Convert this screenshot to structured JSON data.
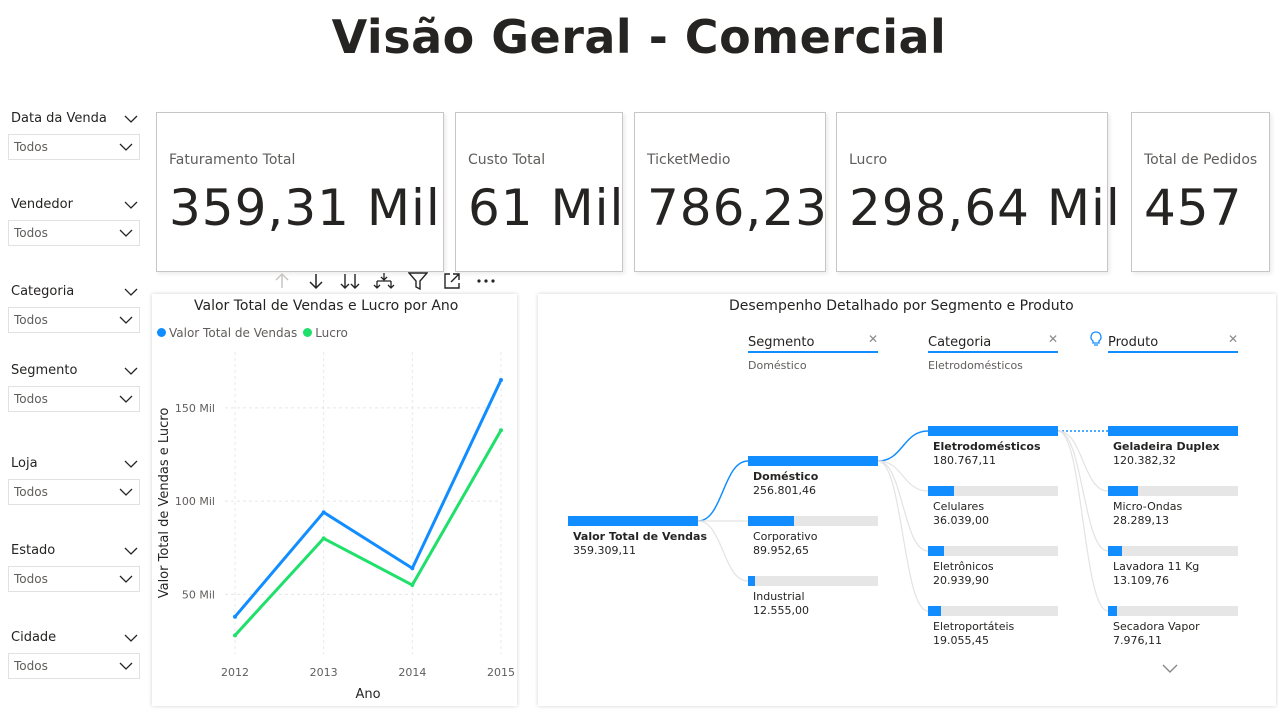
{
  "page_title": "Visão Geral - Comercial",
  "slicers": [
    {
      "label": "Data da Venda",
      "value": "Todos"
    },
    {
      "label": "Vendedor",
      "value": "Todos"
    },
    {
      "label": "Categoria",
      "value": "Todos"
    },
    {
      "label": "Segmento",
      "value": "Todos"
    },
    {
      "label": "Loja",
      "value": "Todos"
    },
    {
      "label": "Estado",
      "value": "Todos"
    },
    {
      "label": "Cidade",
      "value": "Todos"
    }
  ],
  "cards": [
    {
      "label": "Faturamento Total",
      "value": "359,31 Mil"
    },
    {
      "label": "Custo Total",
      "value": "61 Mil"
    },
    {
      "label": "TicketMedio",
      "value": "786,23"
    },
    {
      "label": "Lucro",
      "value": "298,64 Mil"
    },
    {
      "label": "Total de Pedidos",
      "value": "457"
    }
  ],
  "toolbar_icons": [
    "arrow-up-icon",
    "arrow-down-icon",
    "double-arrow-down-icon",
    "expand-hierarchy-icon",
    "filter-icon",
    "focus-mode-icon",
    "more-options-icon"
  ],
  "line_chart": {
    "title": "Valor Total de Vendas e Lucro por Ano",
    "legend": [
      "Valor Total de Vendas",
      "Lucro"
    ],
    "colors": {
      "Valor Total de Vendas": "#118dff",
      "Lucro": "#1ee06a"
    }
  },
  "chart_data": {
    "type": "line",
    "title": "Valor Total de Vendas e Lucro por Ano",
    "xlabel": "Ano",
    "ylabel": "Valor Total de Vendas e Lucro",
    "x": [
      "2012",
      "2013",
      "2014",
      "2015"
    ],
    "yticks": [
      50000,
      100000,
      150000
    ],
    "ytick_labels": [
      "50 Mil",
      "100 Mil",
      "150 Mil"
    ],
    "ylim": [
      18000,
      180000
    ],
    "grid": true,
    "legend_position": "top-left",
    "series": [
      {
        "name": "Valor Total de Vendas",
        "values": [
          38000,
          94000,
          64000,
          165000
        ]
      },
      {
        "name": "Lucro",
        "values": [
          28000,
          80000,
          55000,
          138000
        ]
      }
    ]
  },
  "decomposition": {
    "title": "Desempenho Detalhado por Segmento e Produto",
    "columns": [
      {
        "label": "Segmento",
        "selected": "Doméstico"
      },
      {
        "label": "Categoria",
        "selected": "Eletrodomésticos"
      },
      {
        "label": "Produto",
        "selected": ""
      }
    ],
    "root": {
      "label": "Valor Total de Vendas",
      "value": "359.309,11",
      "fraction": 1.0
    },
    "segments": [
      {
        "label": "Doméstico",
        "value": "256.801,46",
        "fraction": 1.0,
        "selected": true
      },
      {
        "label": "Corporativo",
        "value": "89.952,65",
        "fraction": 0.35
      },
      {
        "label": "Industrial",
        "value": "12.555,00",
        "fraction": 0.05
      }
    ],
    "categories": [
      {
        "label": "Eletrodomésticos",
        "value": "180.767,11",
        "fraction": 1.0,
        "selected": true
      },
      {
        "label": "Celulares",
        "value": "36.039,00",
        "fraction": 0.2
      },
      {
        "label": "Eletrônicos",
        "value": "20.939,90",
        "fraction": 0.12
      },
      {
        "label": "Eletroportáteis",
        "value": "19.055,45",
        "fraction": 0.1
      }
    ],
    "products": [
      {
        "label": "Geladeira Duplex",
        "value": "120.382,32",
        "fraction": 1.0,
        "selected": true
      },
      {
        "label": "Micro-Ondas",
        "value": "28.289,13",
        "fraction": 0.23
      },
      {
        "label": "Lavadora 11 Kg",
        "value": "13.109,76",
        "fraction": 0.11
      },
      {
        "label": "Secadora Vapor",
        "value": "7.976,11",
        "fraction": 0.07
      }
    ]
  }
}
